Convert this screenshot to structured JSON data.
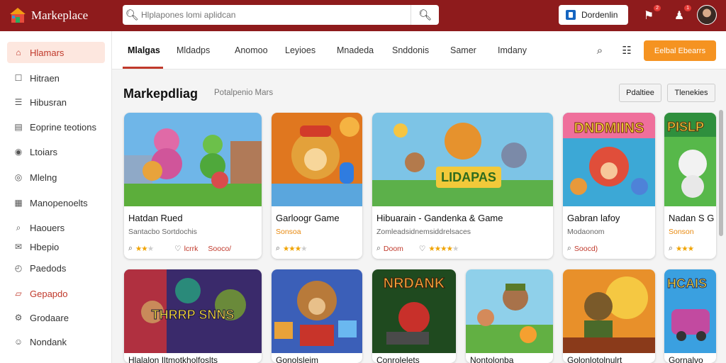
{
  "app": {
    "title": "Markeplace"
  },
  "search": {
    "placeholder": "Hlplapones lomi aplidcan"
  },
  "header": {
    "dashboard_label": "Dordenlin",
    "badge_notifications": "2",
    "badge_account": "1"
  },
  "sidebar": {
    "items": [
      {
        "label": "Hlamars",
        "icon": "home-icon"
      },
      {
        "label": "Hitraen",
        "icon": "document-icon"
      },
      {
        "label": "Hibusran",
        "icon": "list-icon"
      },
      {
        "label": "Eoprine teotions",
        "icon": "file-icon"
      },
      {
        "label": "Ltoiars",
        "icon": "location-icon"
      },
      {
        "label": "Mlelng",
        "icon": "target-icon"
      },
      {
        "label": "Manopenoelts",
        "icon": "calendar-icon"
      },
      {
        "label": "Haouers",
        "icon": "search-icon"
      },
      {
        "label": "Hbepio",
        "icon": "chat-icon"
      },
      {
        "label": "Paedods",
        "icon": "clock-icon"
      },
      {
        "label": "Gepapdo",
        "icon": "bag-icon"
      },
      {
        "label": "Grodaare",
        "icon": "settings-icon"
      },
      {
        "label": "Nondank",
        "icon": "user-icon"
      }
    ]
  },
  "tabs": [
    {
      "label": "Mlalgas"
    },
    {
      "label": "Mldadps"
    },
    {
      "label": "Anomoo"
    },
    {
      "label": "Leyioes"
    },
    {
      "label": "Mnadeda"
    },
    {
      "label": "Snddonis"
    },
    {
      "label": "Samer"
    },
    {
      "label": "Imdany"
    }
  ],
  "tab_actions": {
    "action_label": "Eelbal Ebearrs"
  },
  "content": {
    "title": "Markepdliag",
    "subtitle": "Potalpenio Mars",
    "filter_label": "Pdaltiee",
    "sort_label": "Tlenekies"
  },
  "cards": [
    {
      "title": "Hatdan Rued",
      "meta": "Santacbo Sortdochis",
      "meta_color": "gray",
      "price": "lcrrk",
      "extra": "Sooco/",
      "rating": 3
    },
    {
      "title": "Garloogr Game",
      "meta": "Sonsoa",
      "meta_color": "orange",
      "price": "",
      "extra": "",
      "rating": 3
    },
    {
      "title": "Hibuarain - Gandenka & Game",
      "meta": "Zomleadsidnemsiddrelsaces",
      "meta_color": "gray",
      "price": "Doom",
      "extra": "",
      "rating": 4
    },
    {
      "title": "Gabran lafoy",
      "meta": "Modaonom",
      "meta_color": "gray",
      "price": "Soocd)",
      "extra": "",
      "rating": 0
    },
    {
      "title": "Nadan S G",
      "meta": "Sonson",
      "meta_color": "orange",
      "price": "",
      "extra": "",
      "rating": 4
    }
  ],
  "card_art_titles": {
    "card3": "LIDAPAS",
    "card4": "DNDMIINS",
    "card5": "PISLP",
    "row2_card1": "THRRP SNNS",
    "row2_card3": "NRDANK",
    "row2_card6": "HCAIS"
  },
  "row2_titles": [
    "Hlalalon Iltmotkholfoslts",
    "Gonolsleim",
    "Conrolelets",
    "Nontolonba",
    "Golonlotolnulrt",
    "Gornalvo"
  ]
}
